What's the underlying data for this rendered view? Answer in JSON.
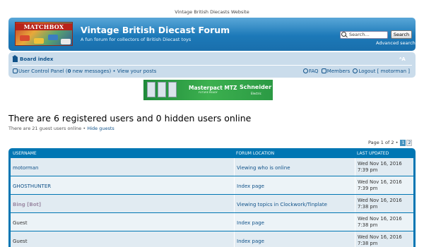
{
  "site_title": "Vintage British Diecasts Website",
  "header": {
    "logo_text": "MATCHBOX",
    "forum_title": "Vintage British Diecast Forum",
    "forum_description": "A fun forum for collectors of British Diecast toys",
    "search_placeholder": "Search…",
    "search_button": "Search",
    "advanced_search": "Advanced search"
  },
  "navbar": {
    "board_index": "Board index",
    "ucp_prefix": "User Control Panel (",
    "new_messages_count": "0",
    "ucp_suffix": " new messages)",
    "separator": "•",
    "view_posts": "View your posts",
    "faq": "FAQ",
    "members": "Members",
    "logout": "Logout [ motorman ]"
  },
  "banner": {
    "product": "Masterpact MTZ",
    "tagline": "FUTURE READY",
    "brand": "Schneider",
    "brand_sub": "Electric"
  },
  "main": {
    "heading": "There are 6 registered users and 0 hidden users online",
    "guest_text": "There are 21 guest users online",
    "separator": "•",
    "hide_guests": "Hide guests"
  },
  "pagination": {
    "label": "Page 1 of 2",
    "separator": "•",
    "pages": [
      "1",
      "2"
    ],
    "current": 1
  },
  "table": {
    "columns": [
      "USERNAME",
      "FORUM LOCATION",
      "LAST UPDATED"
    ],
    "rows": [
      {
        "username": "motorman",
        "location": "Viewing who is online",
        "date": "Wed Nov 16, 2016",
        "time": "7:39 pm"
      },
      {
        "username": "GHOSTHUNTER",
        "location": "Index page",
        "date": "Wed Nov 16, 2016",
        "time": "7:39 pm"
      },
      {
        "username": "Bing [Bot]",
        "location": "Viewing topics in Clockwork/Tinplate",
        "date": "Wed Nov 16, 2016",
        "time": "7:38 pm"
      },
      {
        "username": "Guest",
        "location": "Index page",
        "date": "Wed Nov 16, 2016",
        "time": "7:38 pm"
      },
      {
        "username": "Guest",
        "location": "Index page",
        "date": "Wed Nov 16, 2016",
        "time": "7:38 pm"
      }
    ]
  },
  "colors": {
    "header_blue": "#1c79b8",
    "link_blue": "#105289",
    "table_header": "#0076b3",
    "row_odd": "#e1ebf2",
    "row_even": "#ecf3f7",
    "bot_color": "#9e8da7"
  }
}
